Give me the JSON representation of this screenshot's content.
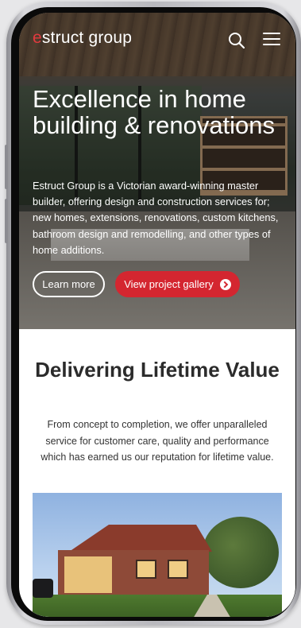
{
  "header": {
    "logo_prefix": "e",
    "logo_rest": "struct group",
    "search_icon": "search-icon",
    "menu_icon": "hamburger-menu-icon"
  },
  "hero": {
    "title": "Excellence in home building & renovations",
    "description": "Estruct Group is a Victorian award-winning master builder, offering design and construction services for; new homes, extensions, renovations, custom kitchens, bathroom design and remodelling, and other types of home additions.",
    "learn_more_label": "Learn more",
    "gallery_label": "View project gallery"
  },
  "section": {
    "title": "Delivering Lifetime Value",
    "description": "From concept to completion, we offer unparalleled service for customer care, quality and performance which has earned us our reputation for lifetime value."
  },
  "colors": {
    "brand_red": "#d42630",
    "logo_red": "#e03a3e",
    "heading": "#2b2b2b"
  }
}
